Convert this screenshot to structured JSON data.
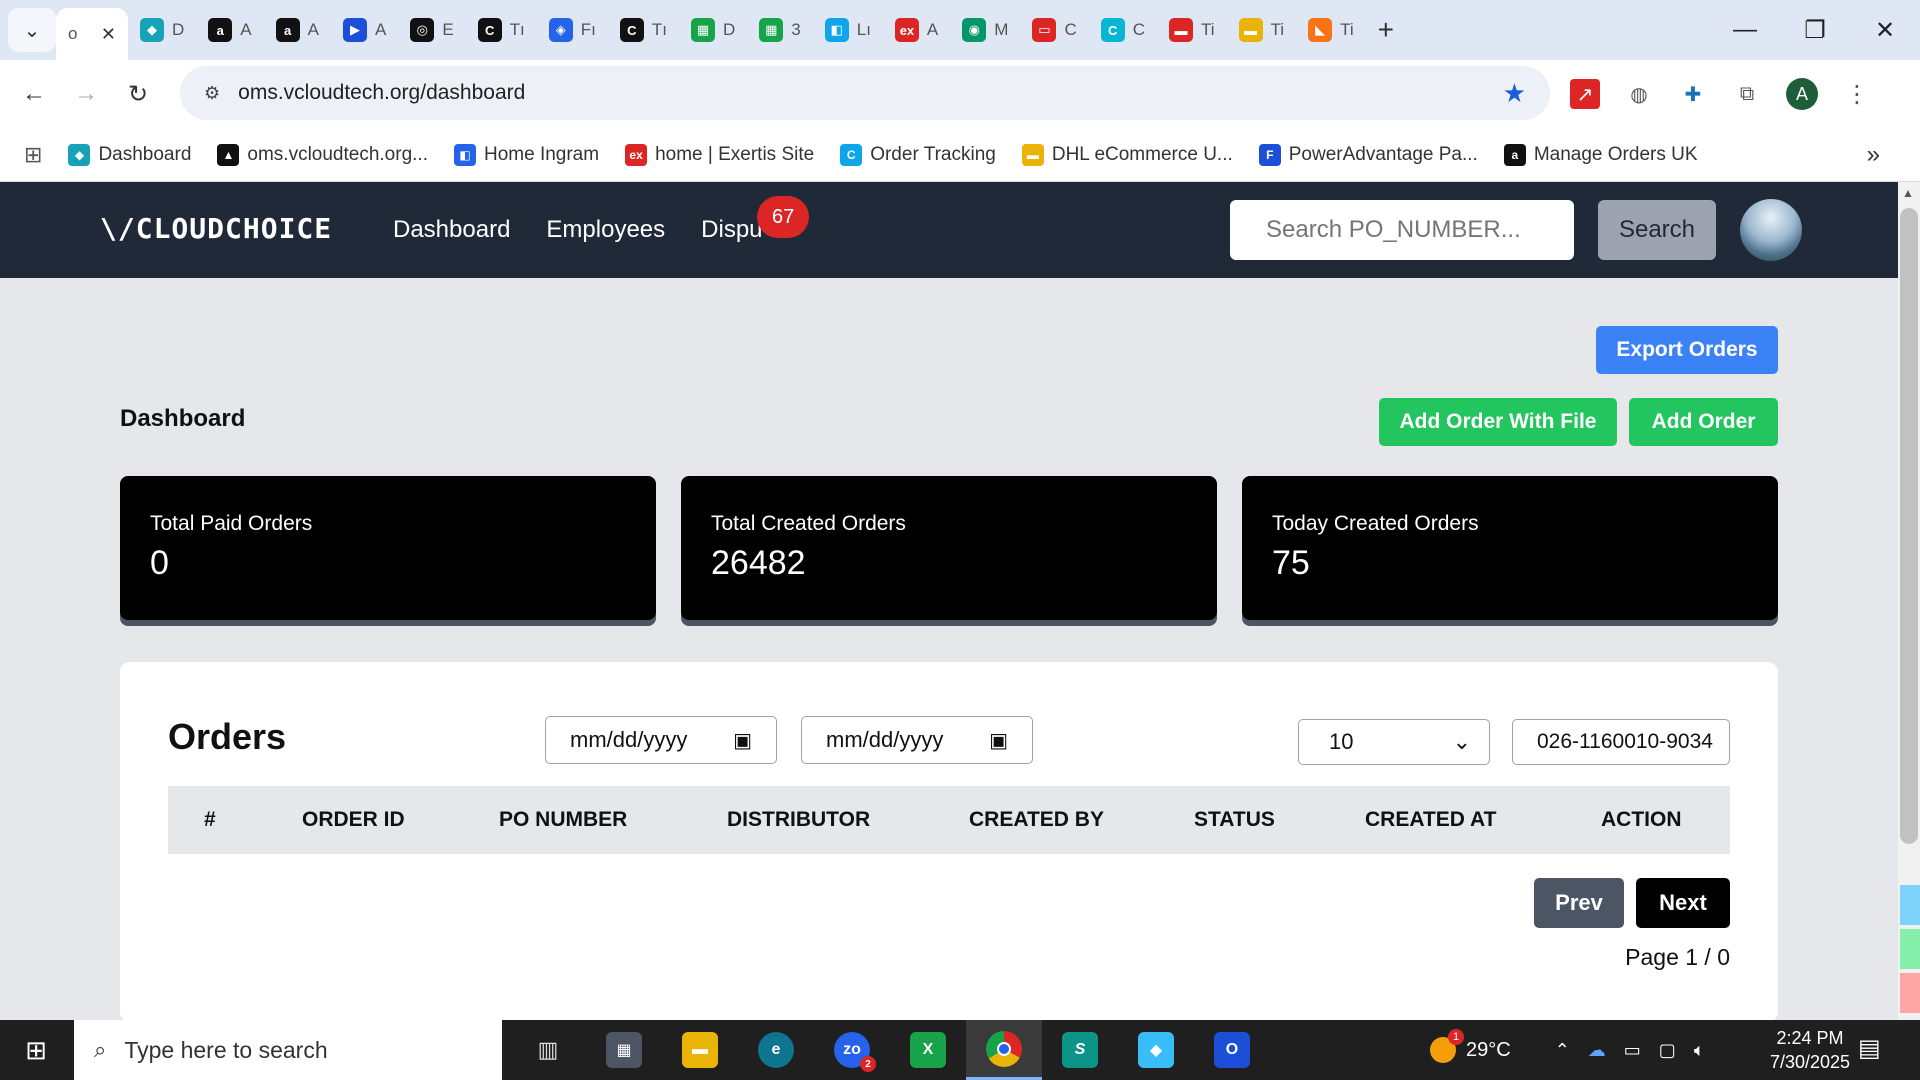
{
  "browser": {
    "tabs": [
      {
        "label": "o",
        "icon": "",
        "color": "#ffffff",
        "active": true
      },
      {
        "label": "D",
        "icon": "◆",
        "color": "#16a3b8"
      },
      {
        "label": "A",
        "icon": "a",
        "color": "#111111"
      },
      {
        "label": "A",
        "icon": "a",
        "color": "#111111"
      },
      {
        "label": "A",
        "icon": "▶",
        "color": "#1d4ed8"
      },
      {
        "label": "E",
        "icon": "◎",
        "color": "#111111"
      },
      {
        "label": "Tı",
        "icon": "C",
        "color": "#111111"
      },
      {
        "label": "Fı",
        "icon": "◈",
        "color": "#2563eb"
      },
      {
        "label": "Tı",
        "icon": "C",
        "color": "#111111"
      },
      {
        "label": "D",
        "icon": "▦",
        "color": "#16a34a"
      },
      {
        "label": "3",
        "icon": "▦",
        "color": "#16a34a"
      },
      {
        "label": "Lı",
        "icon": "◧",
        "color": "#0ea5e9"
      },
      {
        "label": "A",
        "icon": "ex",
        "color": "#dc2626"
      },
      {
        "label": "M",
        "icon": "◉",
        "color": "#059669"
      },
      {
        "label": "C",
        "icon": "▭",
        "color": "#dc2626"
      },
      {
        "label": "C",
        "icon": "C",
        "color": "#06b6d4"
      },
      {
        "label": "Ti",
        "icon": "▬",
        "color": "#dc2626"
      },
      {
        "label": "Ti",
        "icon": "▬",
        "color": "#eab308"
      },
      {
        "label": "Ti",
        "icon": "◣",
        "color": "#f97316"
      }
    ],
    "new_tab": "+",
    "url": "oms.vcloudtech.org/dashboard",
    "bookmarks": [
      {
        "label": "Dashboard",
        "icon": "◆",
        "color": "#16a3b8"
      },
      {
        "label": "oms.vcloudtech.org...",
        "icon": "▲",
        "color": "#111111"
      },
      {
        "label": "Home Ingram",
        "icon": "◧",
        "color": "#2563eb"
      },
      {
        "label": "home | Exertis Site",
        "icon": "ex",
        "color": "#dc2626"
      },
      {
        "label": "Order Tracking",
        "icon": "C",
        "color": "#0ea5e9"
      },
      {
        "label": "DHL eCommerce U...",
        "icon": "▬",
        "color": "#eab308"
      },
      {
        "label": "PowerAdvantage Pa...",
        "icon": "F",
        "color": "#1d4ed8"
      },
      {
        "label": "Manage Orders UK",
        "icon": "a",
        "color": "#111111"
      }
    ],
    "profile_initial": "A"
  },
  "app": {
    "logo": "\\/CLOUDCHOICE",
    "nav": {
      "dashboard": "Dashboard",
      "employees": "Employees",
      "disputes": "Dispu",
      "disputes_badge": "67"
    },
    "search": {
      "placeholder": "Search PO_NUMBER...",
      "button": "Search"
    }
  },
  "dashboard": {
    "export_button": "Export Orders",
    "title": "Dashboard",
    "add_file_button": "Add Order With File",
    "add_button": "Add Order",
    "stats": [
      {
        "label": "Total Paid Orders",
        "value": "0"
      },
      {
        "label": "Total Created Orders",
        "value": "26482"
      },
      {
        "label": "Today Created Orders",
        "value": "75"
      }
    ]
  },
  "orders": {
    "title": "Orders",
    "date_from_placeholder": "mm/dd/yyyy",
    "date_to_placeholder": "mm/dd/yyyy",
    "per_page": "10",
    "filter_value": "026-1160010-9034",
    "columns": [
      "#",
      "ORDER ID",
      "PO NUMBER",
      "DISTRIBUTOR",
      "CREATED BY",
      "STATUS",
      "CREATED AT",
      "ACTION"
    ],
    "prev": "Prev",
    "next": "Next",
    "page_info": "Page 1 / 0"
  },
  "taskbar": {
    "search_placeholder": "Type here to search",
    "weather": "29°C",
    "weather_badge": "1",
    "time": "2:24 PM",
    "date": "7/30/2025",
    "zoom_badge": "2"
  }
}
